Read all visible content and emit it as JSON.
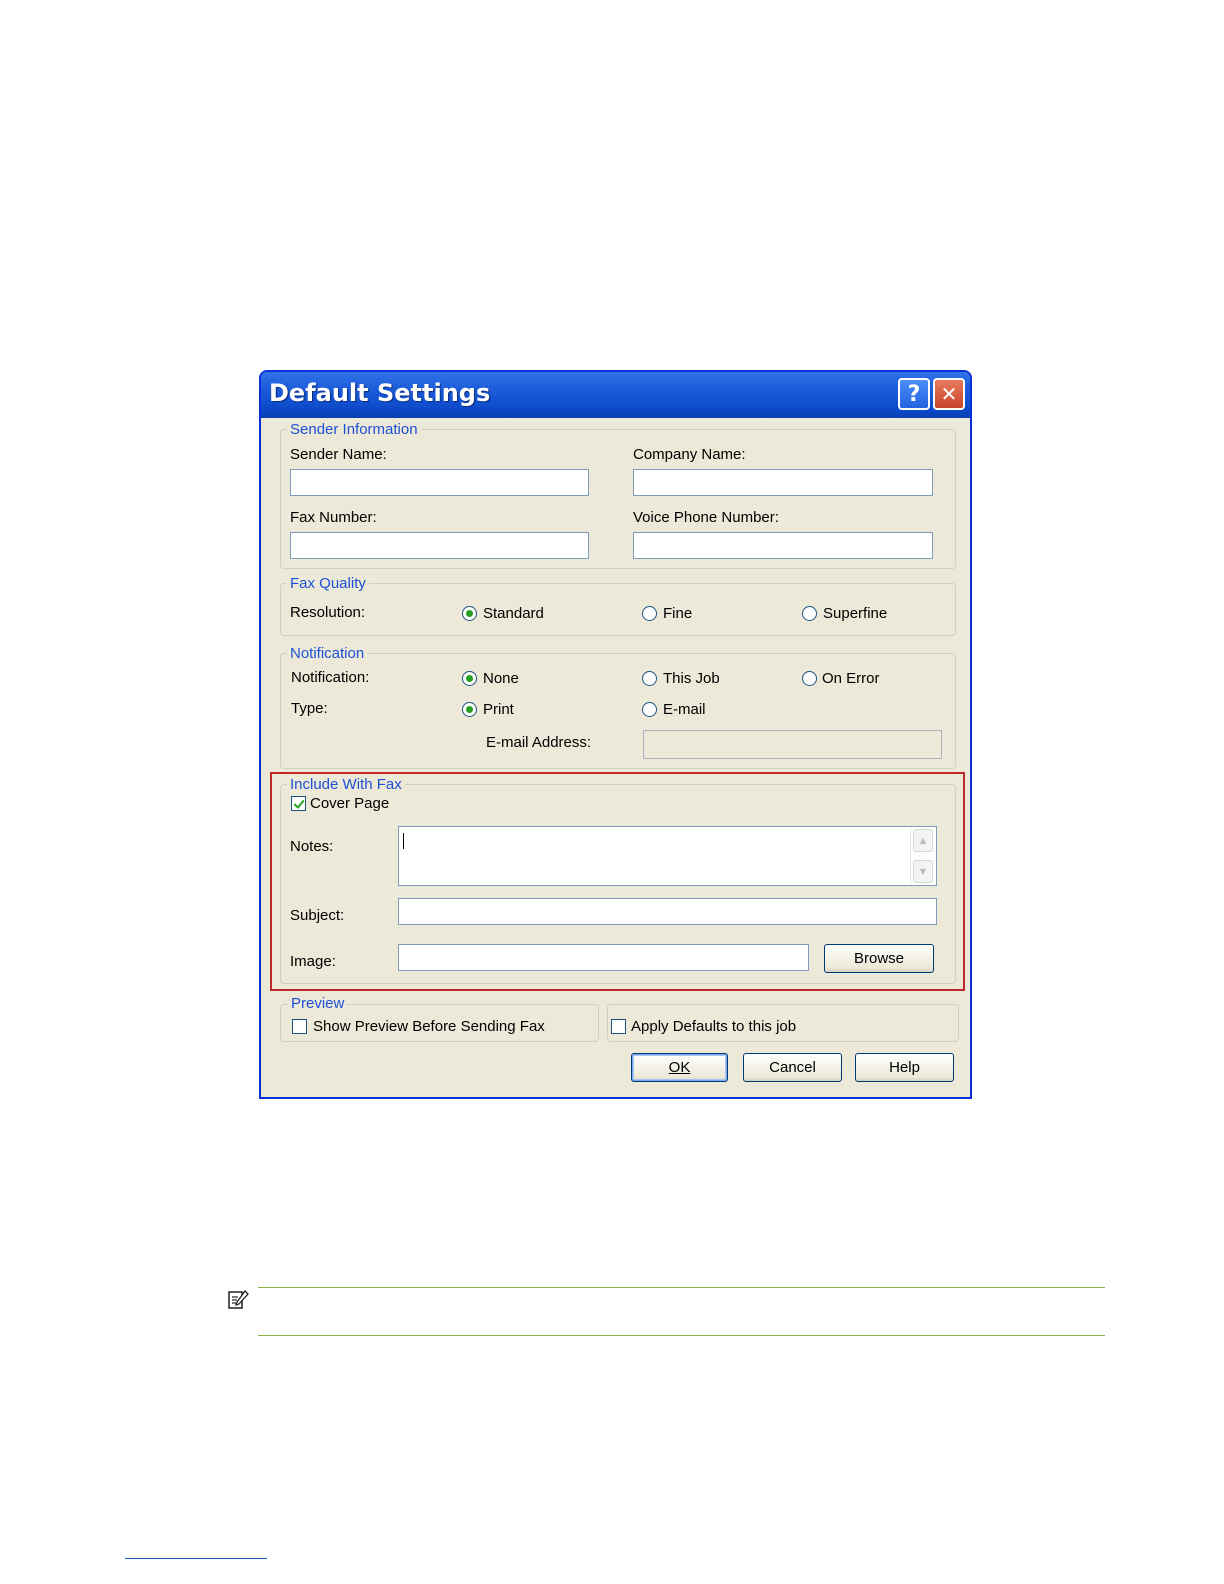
{
  "dialog": {
    "title": "Default Settings",
    "help_button": "?",
    "close_button": "✕"
  },
  "sender": {
    "legend": "Sender Information",
    "sender_name_label": "Sender Name:",
    "sender_name_value": "",
    "company_name_label": "Company Name:",
    "company_name_value": "",
    "fax_number_label": "Fax Number:",
    "fax_number_value": "",
    "voice_phone_label": "Voice Phone Number:",
    "voice_phone_value": ""
  },
  "quality": {
    "legend": "Fax Quality",
    "resolution_label": "Resolution:",
    "options": [
      "Standard",
      "Fine",
      "Superfine"
    ],
    "selected": "Standard"
  },
  "notification": {
    "legend": "Notification",
    "notification_label": "Notification:",
    "notification_options": [
      "None",
      "This Job",
      "On Error"
    ],
    "notification_selected": "None",
    "type_label": "Type:",
    "type_options": [
      "Print",
      "E-mail"
    ],
    "type_selected": "Print",
    "email_label": "E-mail Address:",
    "email_value": ""
  },
  "include": {
    "legend": "Include With Fax",
    "cover_page_label": "Cover Page",
    "cover_page_checked": true,
    "notes_label": "Notes:",
    "notes_value": "",
    "subject_label": "Subject:",
    "subject_value": "",
    "image_label": "Image:",
    "image_value": "",
    "browse_label": "Browse"
  },
  "preview": {
    "legend": "Preview",
    "show_preview_label": "Show Preview Before Sending Fax",
    "show_preview_checked": false,
    "apply_defaults_label": "Apply Defaults to this job",
    "apply_defaults_checked": false
  },
  "buttons": {
    "ok": "OK",
    "cancel": "Cancel",
    "help": "Help"
  },
  "colors": {
    "titlebar": "#0a48c8",
    "dialog_bg": "#ece9d8",
    "legend_text": "#1e4fd6",
    "highlight_border": "#c1272d",
    "note_rule": "#8cb34a"
  },
  "icons": {
    "note": "note-pencil-icon"
  }
}
